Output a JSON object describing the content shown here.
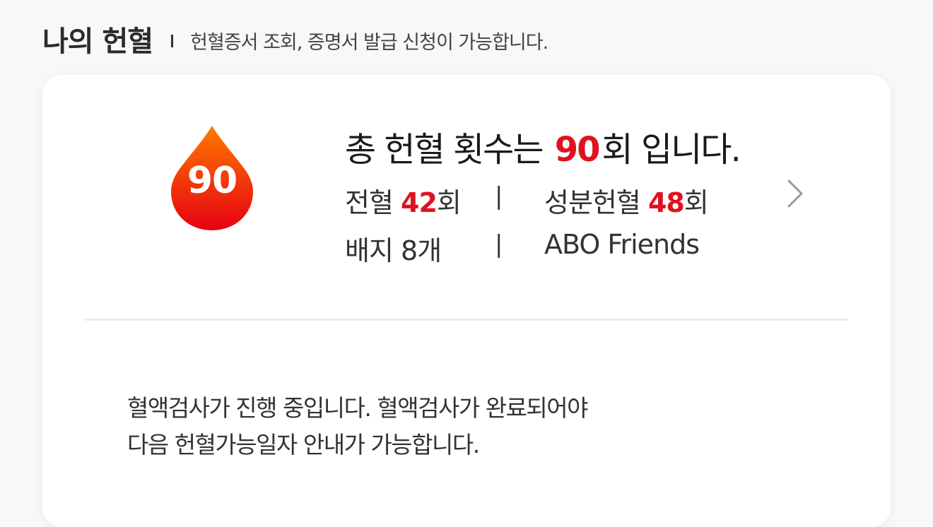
{
  "header": {
    "title": "나의 헌혈",
    "subtitle": "헌혈증서 조회, 증명서 발급 신청이 가능합니다."
  },
  "summary": {
    "drop_count": "90",
    "prefix": "총 헌혈 횟수는",
    "count": "90",
    "suffix": "회 입니다."
  },
  "stats": {
    "whole_blood_label": "전혈",
    "whole_blood_count": "42",
    "whole_blood_unit": "회",
    "component_label": "성분헌혈",
    "component_count": "48",
    "component_unit": "회",
    "badge_label": "배지",
    "badge_count": "8",
    "badge_unit": "개",
    "badge_name": "ABO Friends",
    "separator": "|"
  },
  "notice": {
    "line1": "혈액검사가 진행 중입니다. 혈액검사가 완료되어야",
    "line2": "다음 헌혈가능일자 안내가 가능합니다."
  },
  "colors": {
    "accent": "#e1121f",
    "drop_top": "#ff7a00",
    "drop_bottom": "#e60012"
  },
  "icons": {
    "drop": "blood-drop-icon",
    "chevron": "chevron-right-icon"
  }
}
